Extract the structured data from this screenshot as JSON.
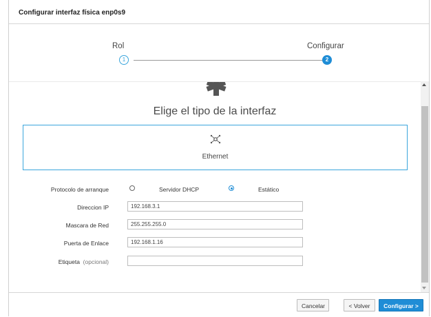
{
  "dialog": {
    "title": "Configurar interfaz física enp0s9"
  },
  "steps": [
    {
      "label": "Rol",
      "number": "1"
    },
    {
      "label": "Configurar",
      "number": "2"
    }
  ],
  "main": {
    "heading": "Elige el tipo de la interfaz",
    "interface_type": "Ethernet"
  },
  "form": {
    "boot_protocol_label": "Protocolo de arranque",
    "boot_options": [
      {
        "label": "Servidor DHCP",
        "selected": false
      },
      {
        "label": "Estático",
        "selected": true
      }
    ],
    "ip_label": "Direccion IP",
    "ip_value": "192.168.3.1",
    "netmask_label": "Mascara de Red",
    "netmask_value": "255.255.255.0",
    "gateway_label": "Puerta de Enlace",
    "gateway_value": "192.168.1.16",
    "tag_label": "Etiqueta",
    "tag_optional": "(opcional)",
    "tag_value": ""
  },
  "footer": {
    "cancel": "Cancelar",
    "back": "< Volver",
    "configure": "Configurar >"
  },
  "colors": {
    "accent": "#1f8dd6",
    "card_border": "#39a5dc"
  }
}
